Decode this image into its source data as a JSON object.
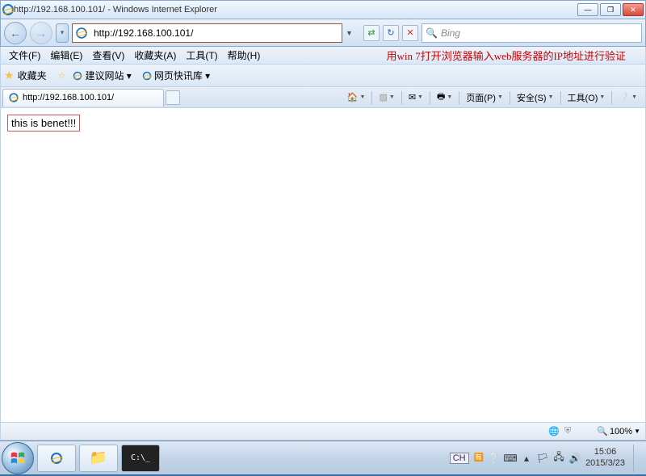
{
  "window": {
    "title": "http://192.168.100.101/ - Windows Internet Explorer"
  },
  "nav": {
    "url": "http://192.168.100.101/",
    "search_placeholder": "Bing"
  },
  "menu": {
    "file": "文件(F)",
    "edit": "编辑(E)",
    "view": "查看(V)",
    "favorites": "收藏夹(A)",
    "tools": "工具(T)",
    "help": "帮助(H)"
  },
  "annotation": "用win 7打开浏览器输入web服务器的IP地址进行验证",
  "favbar": {
    "label": "收藏夹",
    "suggested": "建议网站 ▾",
    "express": "网页快讯库 ▾"
  },
  "tab": {
    "title": "http://192.168.100.101/"
  },
  "toolbar": {
    "page": "页面(P)",
    "safety": "安全(S)",
    "tools": "工具(O)"
  },
  "page": {
    "body": "this is benet!!!"
  },
  "status": {
    "zoom": "100%"
  },
  "tray": {
    "ime": "CH",
    "time": "15:06",
    "date": "2015/3/23"
  }
}
